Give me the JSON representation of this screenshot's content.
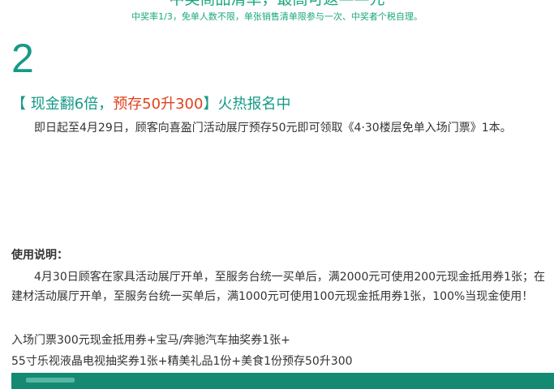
{
  "colors": {
    "accent": "#159a86",
    "highlight": "#e0431f",
    "text": "#333333",
    "footer_bar": "#148a73"
  },
  "header": {
    "cut_headline": "中奖商品清单，最高可返——元",
    "note": "中奖率1/3，免单人数不限，单张销售清单限参与一次、中奖者个税自理。"
  },
  "section": {
    "number": "2",
    "title_open": "【 现金翻6倍，",
    "title_highlight": "预存50升300",
    "title_close": "】火热报名中",
    "intro": "即日起至4月29日，顾客向喜盈门活动展厅预存50元即可领取《4·30楼层免单入场门票》1本。"
  },
  "usage": {
    "label": "使用说明：",
    "paragraph": "4月30日顾客在家具活动展厅开单，至服务台统一买单后，满2000元可使用200元现金抵用券1张；在建材活动展厅开单，至服务台统一买单后，满1000元可使用100元现金抵用券1张，100%当现金使用！",
    "line1": "入场门票300元现金抵用券+宝马/奔驰汽车抽奖券1张+",
    "line2": "55寸乐视液晶电视抽奖券1张+精美礼品1份+美食1份预存50升300"
  }
}
